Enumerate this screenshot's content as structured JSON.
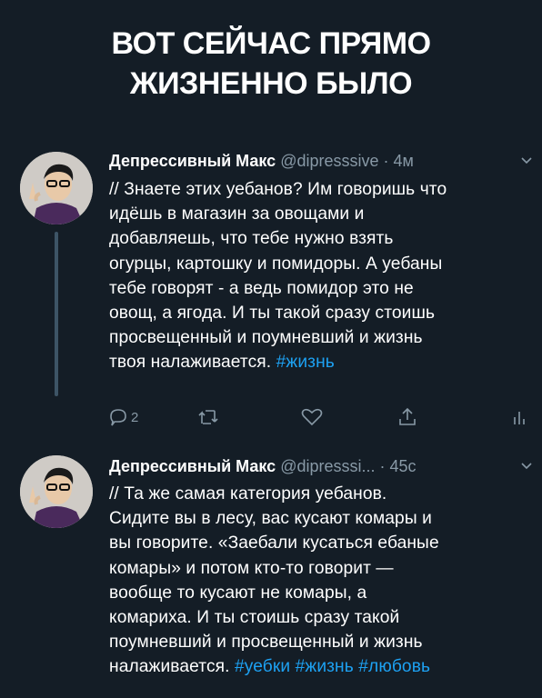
{
  "headline": [
    "ВОТ СЕЙЧАС ПРЯМО",
    "ЖИЗНЕННО БЫЛО"
  ],
  "tweets": [
    {
      "name": "Депрессивный Макс",
      "handle": "@dipresssive",
      "time": "· 4м",
      "lines": [
        "// Знаете этих уебанов? Им говоришь что",
        "идёшь в магазин за овощами и",
        "добавляешь, что тебе нужно взять",
        "огурцы, картошку и помидоры. А уебаны",
        "тебе говорят - а ведь помидор это не",
        "овощ, а ягода. И ты такой сразу стоишь",
        "просвещенный и поумневший и жизнь",
        "твоя налаживается."
      ],
      "hashtags": "#жизнь",
      "reply_count": "2"
    },
    {
      "name": "Депрессивный Макс",
      "handle": "@dipresssi...",
      "time": "· 45с",
      "lines": [
        "// Та же самая категория уебанов.",
        "Сидите вы в лесу, вас кусают комары и",
        "вы говорите. «Заебали кусаться ебаные",
        "комары» и потом кто-то говорит —",
        "вообще то кусают не комары, а",
        "комариха. И ты стоишь сразу такой",
        "поумневший и просвещенный и жизнь",
        "налаживается."
      ],
      "hashtags": "#уебки #жизнь #любовь"
    }
  ],
  "colors": {
    "background": "#141d26",
    "accent": "#1da1f2",
    "muted": "#8899a6"
  }
}
